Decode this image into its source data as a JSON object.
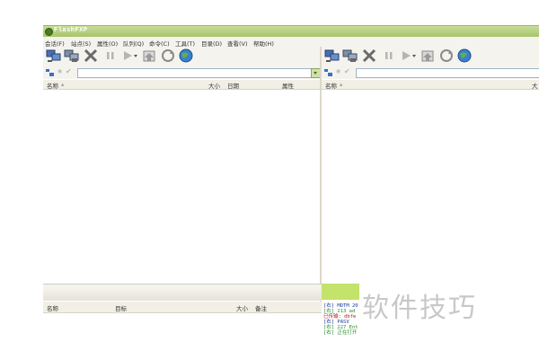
{
  "window": {
    "title": "FlashFXP"
  },
  "menu": [
    "会话(F)",
    "站点(S)",
    "属性(O)",
    "队列(Q)",
    "命令(C)",
    "工具(T)",
    "目录(D)",
    "查看(V)",
    "帮助(H)"
  ],
  "left_pane": {
    "columns": {
      "name": "名称",
      "size": "大小",
      "date": "日期",
      "attr": "属性"
    }
  },
  "right_pane": {
    "columns": {
      "name": "名称",
      "size": "大"
    }
  },
  "queue": {
    "columns": {
      "name": "名称",
      "target": "目标",
      "size": "大小",
      "note": "备注"
    }
  },
  "log": [
    {
      "text": "[右] MDTM 20",
      "color": "#1a3a9a"
    },
    {
      "text": "[右] 213 ad",
      "color": "#2a8a2a"
    },
    {
      "text": "已传输: dbfe",
      "color": "#b02020"
    },
    {
      "text": "[右] PASV",
      "color": "#1a3a9a"
    },
    {
      "text": "[右] 227 Ent",
      "color": "#2a8a2a"
    },
    {
      "text": "[右] 正在打开",
      "color": "#2a8a2a"
    }
  ],
  "watermark": "软件技巧",
  "colors": {
    "title_bar": "#a7c46a",
    "log_band": "#c4e36a"
  }
}
